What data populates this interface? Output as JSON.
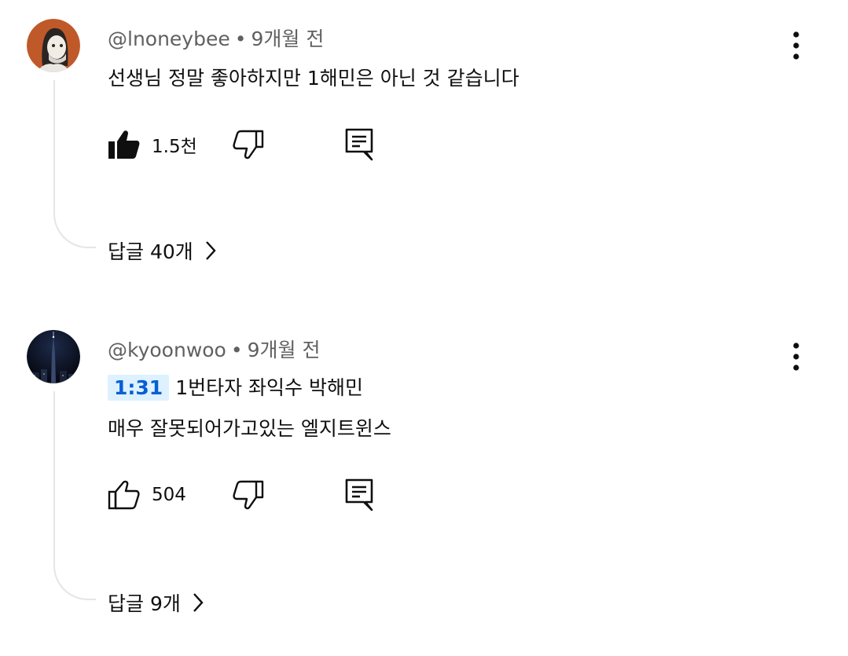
{
  "comments": [
    {
      "handle": "@lnoneybee",
      "separator": "•",
      "time": "9개월 전",
      "timestamp_link": "",
      "lines": [
        "선생님 정말 좋아하지만 1해민은 아닌 것 같습니다"
      ],
      "likes": "1.5천",
      "liked": true,
      "replies_label": "답글 40개",
      "avatar_icon": "illustrated-person-avatar"
    },
    {
      "handle": "@kyoonwoo",
      "separator": "•",
      "time": "9개월 전",
      "timestamp_link": "1:31",
      "lines": [
        "1번타자 좌익수 박해민",
        "매우 잘못되어가고있는 엘지트윈스"
      ],
      "likes": "504",
      "liked": false,
      "replies_label": "답글 9개",
      "avatar_icon": "night-city-tower-avatar"
    }
  ],
  "colors": {
    "meta_text": "#606060",
    "timestamp_bg": "#def1ff",
    "timestamp_text": "#065fd4",
    "thread_line": "#e5e5e5"
  }
}
